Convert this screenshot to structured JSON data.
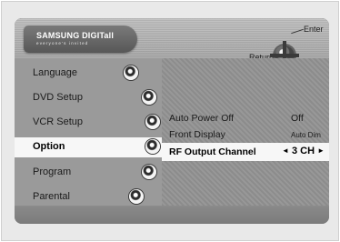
{
  "brand": {
    "logo_text": "SAMSUNG DIGITall",
    "logo_tagline": "everyone's invited"
  },
  "header": {
    "enter_label": "Enter",
    "return_label": "Return"
  },
  "sidebar": {
    "items": [
      {
        "label": "Language",
        "icon": "language-icon",
        "selected": false
      },
      {
        "label": "DVD Setup",
        "icon": "disc-icon",
        "selected": false
      },
      {
        "label": "VCR Setup",
        "icon": "cassette-icon",
        "selected": false
      },
      {
        "label": "Option",
        "icon": "wrench-icon",
        "selected": true
      },
      {
        "label": "Program",
        "icon": "program-icon",
        "selected": false
      },
      {
        "label": "Parental",
        "icon": "lock-icon",
        "selected": false
      }
    ]
  },
  "options": {
    "rows": [
      {
        "label": "Auto Power Off",
        "value": "Off"
      },
      {
        "label": "Front Display",
        "value": "Auto Dim"
      },
      {
        "label": "RF Output Channel",
        "value": "3 CH",
        "left_arrow": "◄",
        "right_arrow": "►",
        "selected": true
      }
    ]
  },
  "colors": {
    "osd_background": "#8e8e8e",
    "selected_highlight": "#f7f7f7",
    "text": "#1a1a1a"
  }
}
